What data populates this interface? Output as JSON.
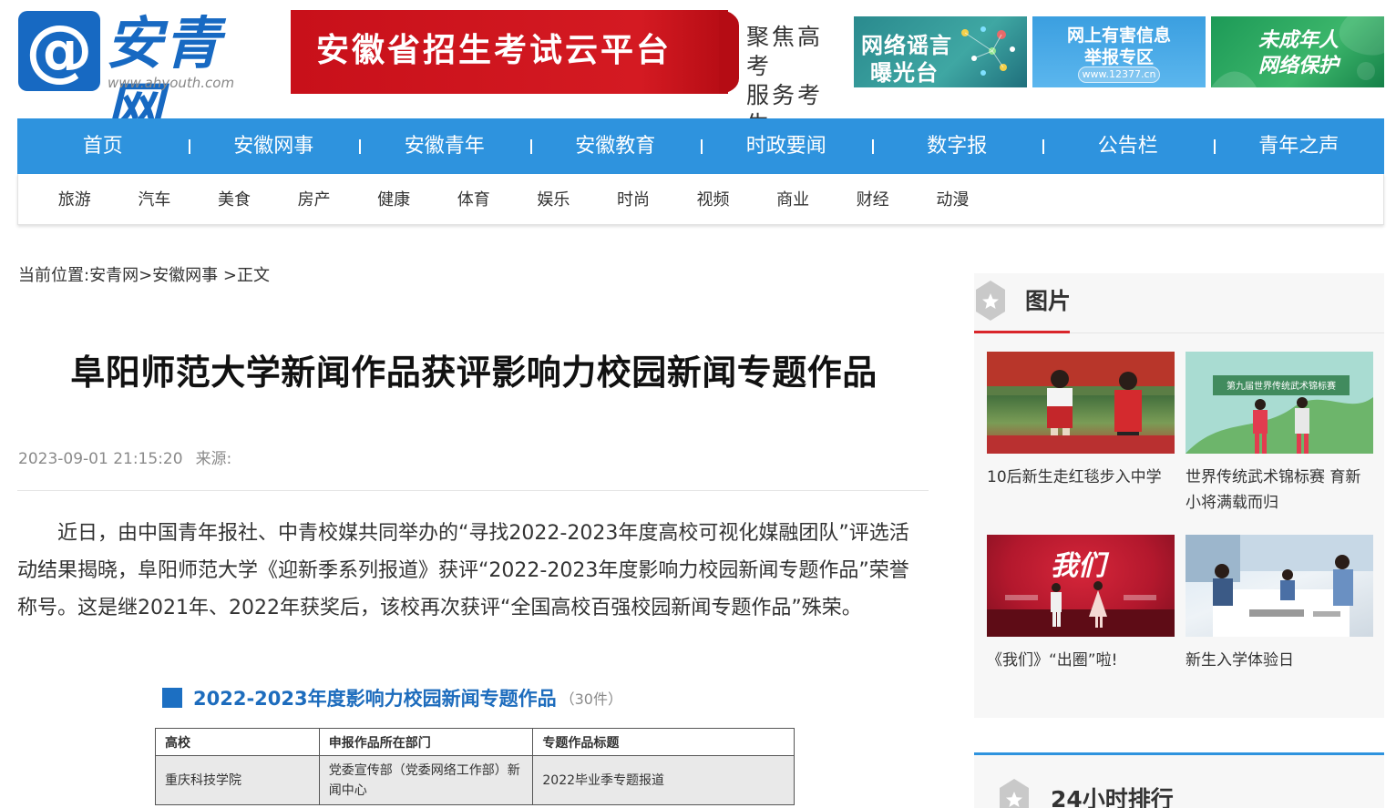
{
  "site": {
    "logo_symbol": "@",
    "logo_name": "安青网",
    "logo_url": "www.ahyouth.com"
  },
  "banners": {
    "main_text": "安徽省招生考试云平台",
    "side_line1": "聚焦高考",
    "side_line2": "服务考生",
    "rumor_line1": "网络谣言",
    "rumor_line2": "曝光台",
    "report_line1": "网上有害信息",
    "report_line2": "举报专区",
    "report_url": "www.12377.cn",
    "youth_line1": "未成年人",
    "youth_line2": "网络保护"
  },
  "nav": {
    "main": [
      "首页",
      "安徽网事",
      "安徽青年",
      "安徽教育",
      "时政要闻",
      "数字报",
      "公告栏",
      "青年之声"
    ],
    "sub": [
      "旅游",
      "汽车",
      "美食",
      "房产",
      "健康",
      "体育",
      "娱乐",
      "时尚",
      "视频",
      "商业",
      "财经",
      "动漫"
    ]
  },
  "breadcrumb": {
    "prefix": "当前位置:",
    "home": "安青网",
    "sep1": ">",
    "section": "安徽网事",
    "sep2": " >",
    "current": "正文"
  },
  "article": {
    "title": "阜阳师范大学新闻作品获评影响力校园新闻专题作品",
    "date": "2023-09-01 21:15:20",
    "source_label": "来源:",
    "body": "近日，由中国青年报社、中青校媒共同举办的“寻找2022-2023年度高校可视化媒融团队”评选活动结果揭晓，阜阳师范大学《迎新季系列报道》获评“2022-2023年度影响力校园新闻专题作品”荣誉称号。这是继2021年、2022年获奖后，该校再次获评“全国高校百强校园新闻专题作品”殊荣。",
    "figure": {
      "title": "2022-2023年度影响力校园新闻专题作品",
      "count": "（30件）",
      "headers": [
        "高校",
        "申报作品所在部门",
        "专题作品标题"
      ],
      "rows": [
        [
          "重庆科技学院",
          "党委宣传部（党委网络工作部）新闻中心",
          "2022毕业季专题报道"
        ]
      ]
    }
  },
  "sidebar": {
    "pictures_title": "图片",
    "pictures": [
      {
        "caption": "10后新生走红毯步入中学"
      },
      {
        "caption": "世界传统武术锦标赛 育新小将满载而归"
      },
      {
        "caption": "《我们》“出圈”啦!"
      },
      {
        "caption": "新生入学体验日"
      }
    ],
    "ranking_title": "24小时排行",
    "img2_text": "第九届世界传统武术锦标赛",
    "img3_text": "我们"
  },
  "colors": {
    "nav_blue": "#2e93de",
    "banner_red": "#c8101a",
    "accent_red": "#d9252a",
    "logo_blue": "#1769c2"
  }
}
